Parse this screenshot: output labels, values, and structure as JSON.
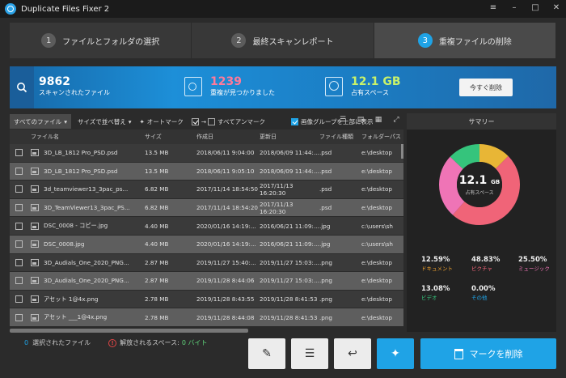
{
  "app": {
    "title": "Duplicate Files Fixer 2"
  },
  "window_controls": [
    "≡",
    "–",
    "□",
    "✕"
  ],
  "steps": [
    {
      "num": "1",
      "label": "ファイルとフォルダの選択",
      "active": false
    },
    {
      "num": "2",
      "label": "最終スキャンレポート",
      "active": false
    },
    {
      "num": "3",
      "label": "重複ファイルの削除",
      "active": true
    }
  ],
  "banner": {
    "scanned_count": "9862",
    "scanned_label": "スキャンされたファイル",
    "duplicates_count": "1239",
    "duplicates_label": "重複が見つかりました",
    "space_value": "12.1 GB",
    "space_label": "占有スペース",
    "delete_now": "今すぐ削除",
    "colors": {
      "duplicates": "#ff7a9a",
      "space": "#c9f26a"
    }
  },
  "toolbar": {
    "all_files": "すべてのファイル",
    "sort_by": "サイズで並べ替え",
    "auto_mark": "オートマーク",
    "unmark_all": "すべてアンマーク",
    "group_images_top": "画像グループを上部に表示",
    "group_images_checked": true
  },
  "table": {
    "headers": [
      "ファイル名",
      "サイズ",
      "作成日",
      "更新日",
      "ファイル種類",
      "フォルダーパス"
    ],
    "rows": [
      {
        "name": "3D_LB_1812 Pro_PSD.psd",
        "size": "13.5 MB",
        "created": "2018/06/11 9:04:00",
        "modified": "2018/06/09 11:44:...",
        "type": ".psd",
        "path": "e:\\desktop",
        "shade": "dark"
      },
      {
        "name": "3D_LB_1812 Pro_PSD.psd",
        "size": "13.5 MB",
        "created": "2018/06/11 9:05:10",
        "modified": "2018/06/09 11:44:...",
        "type": ".psd",
        "path": "e:\\desktop",
        "shade": "light"
      },
      {
        "name": "3d_teamviewer13_3pac_ps...",
        "size": "6.82 MB",
        "created": "2017/11/14 18:54:50",
        "modified": "2017/11/13 16:20:30",
        "type": ".psd",
        "path": "e:\\desktop",
        "shade": "dark"
      },
      {
        "name": "3D_TeamViewer13_3pac_PS...",
        "size": "6.82 MB",
        "created": "2017/11/14 18:54:20",
        "modified": "2017/11/13 16:20:30",
        "type": ".psd",
        "path": "e:\\desktop",
        "shade": "light"
      },
      {
        "name": "DSC_0008 - コピー.jpg",
        "size": "4.40 MB",
        "created": "2020/01/16 14:19:...",
        "modified": "2016/06/21 11:09:...",
        "type": ".jpg",
        "path": "c:\\users\\sh",
        "shade": "dark"
      },
      {
        "name": "DSC_0008.jpg",
        "size": "4.40 MB",
        "created": "2020/01/16 14:19:...",
        "modified": "2016/06/21 11:09:...",
        "type": ".jpg",
        "path": "c:\\users\\sh",
        "shade": "light"
      },
      {
        "name": "3D_Audials_One_2020_PNG...",
        "size": "2.87 MB",
        "created": "2019/11/27 15:40:...",
        "modified": "2019/11/27 15:03:...",
        "type": ".png",
        "path": "e:\\desktop",
        "shade": "dark"
      },
      {
        "name": "3D_Audials_One_2020_PNG...",
        "size": "2.87 MB",
        "created": "2019/11/28 8:44:06",
        "modified": "2019/11/27 15:03:...",
        "type": ".png",
        "path": "e:\\desktop",
        "shade": "light"
      },
      {
        "name": "アセット 1@4x.png",
        "size": "2.78 MB",
        "created": "2019/11/28 8:43:55",
        "modified": "2019/11/28 8:41:53",
        "type": ".png",
        "path": "e:\\desktop",
        "shade": "dark"
      },
      {
        "name": "アセット ___1@4x.png",
        "size": "2.78 MB",
        "created": "2019/11/28 8:44:08",
        "modified": "2019/11/28 8:41:53",
        "type": ".png",
        "path": "e:\\desktop",
        "shade": "light"
      }
    ]
  },
  "summary": {
    "title": "サマリー",
    "center_value": "12.1",
    "center_unit": "GB",
    "center_label": "占有スペース",
    "segments": [
      {
        "name": "ドキュメント",
        "percent": 12.59,
        "color": "#e8b636"
      },
      {
        "name": "ピクチャ",
        "percent": 48.83,
        "color": "#f06478"
      },
      {
        "name": "ミュージック",
        "percent": 25.5,
        "color": "#ef74b6"
      },
      {
        "name": "ビデオ",
        "percent": 13.08,
        "color": "#35c47c"
      },
      {
        "name": "その他",
        "percent": 0.0,
        "color": "#1fa3e6"
      }
    ],
    "legend": [
      {
        "value": "12.59%",
        "label": "ドキュメント",
        "color": "#f0a22e"
      },
      {
        "value": "48.83%",
        "label": "ピクチャ",
        "color": "#f06478"
      },
      {
        "value": "25.50%",
        "label": "ミュージック",
        "color": "#ef74b6"
      },
      {
        "value": "13.08%",
        "label": "ビデオ",
        "color": "#35c47c"
      },
      {
        "value": "0.00%",
        "label": "その他",
        "color": "#1fa3e6"
      }
    ]
  },
  "status": {
    "selected_count": "0",
    "selected_label": "選択されたファイル",
    "freed_label": "解放されるスペース:",
    "freed_value": "0 バイト"
  },
  "actions": {
    "delete_marked": "マークを削除"
  }
}
